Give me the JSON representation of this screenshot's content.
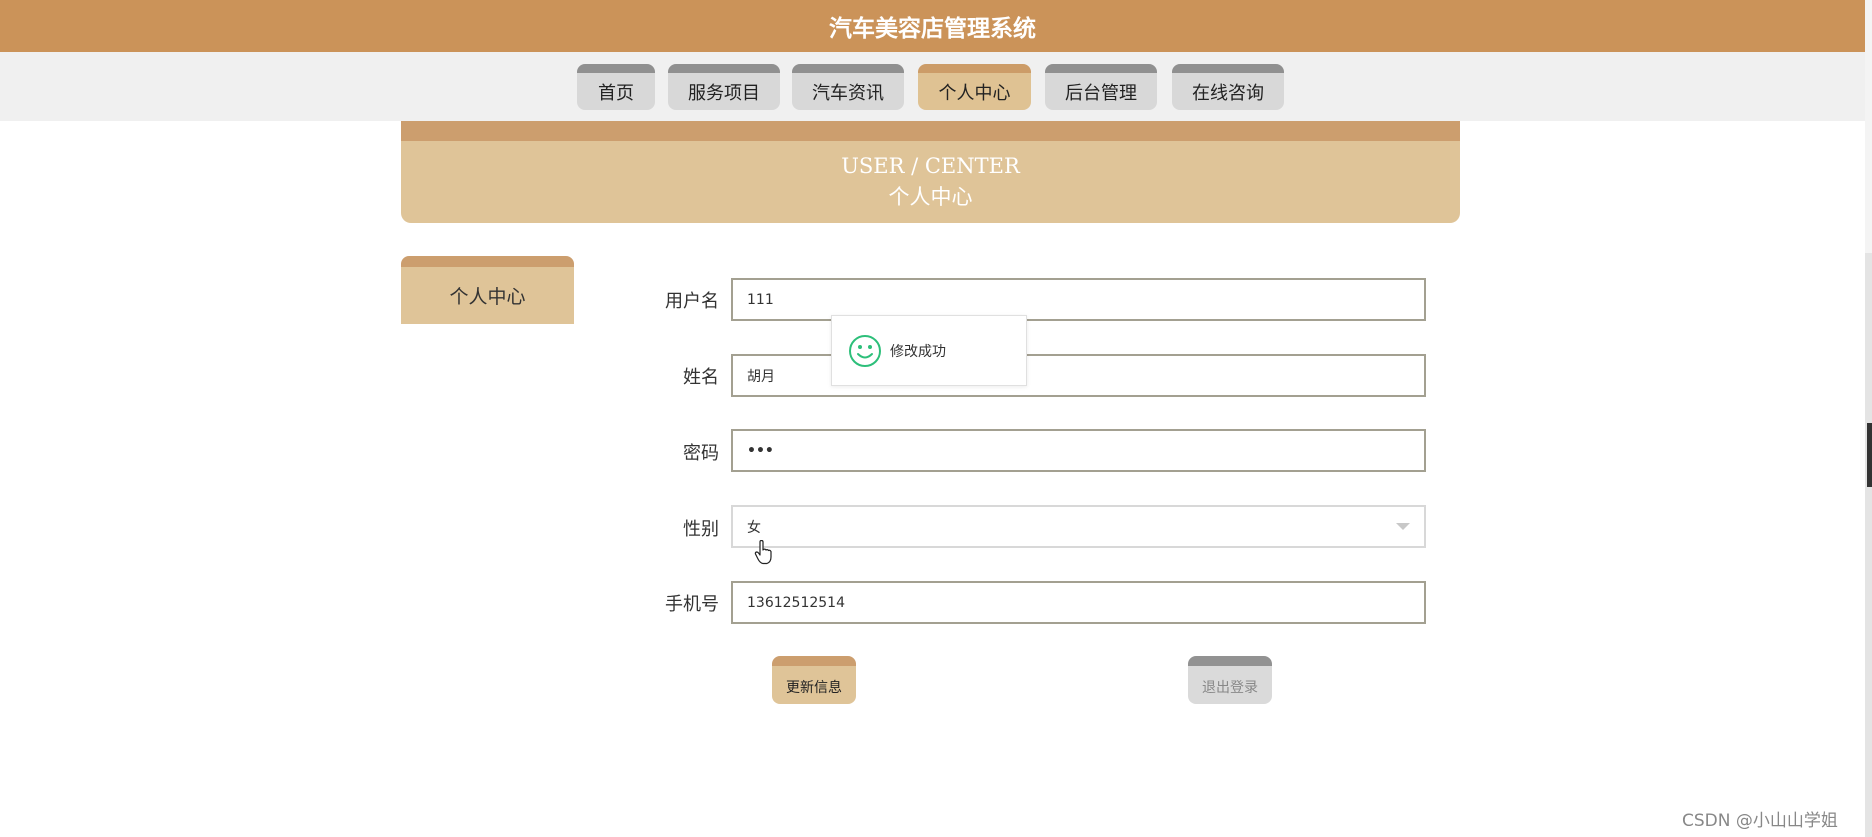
{
  "app_title": "汽车美容店管理系统",
  "nav": {
    "tabs": [
      "首页",
      "服务项目",
      "汽车资讯",
      "个人中心",
      "后台管理",
      "在线咨询"
    ],
    "active": "个人中心"
  },
  "banner": {
    "en": "USER / CENTER",
    "cn": "个人中心"
  },
  "sidebar": {
    "item": "个人中心"
  },
  "form": {
    "username_label": "用户名",
    "username_value": "111",
    "name_label": "姓名",
    "name_value": "胡月",
    "password_label": "密码",
    "password_value": "•••",
    "gender_label": "性别",
    "gender_value": "女",
    "phone_label": "手机号",
    "phone_value": "13612512514"
  },
  "buttons": {
    "update": "更新信息",
    "logout": "退出登录"
  },
  "toast": {
    "message": "修改成功"
  },
  "watermark": "CSDN @小山山学姐",
  "colors": {
    "header": "#cb9359",
    "accent": "#dfc498",
    "accent_dark": "#cc9e6e",
    "tab_inactive": "#d8d8d8",
    "success": "#2dbf7a"
  }
}
